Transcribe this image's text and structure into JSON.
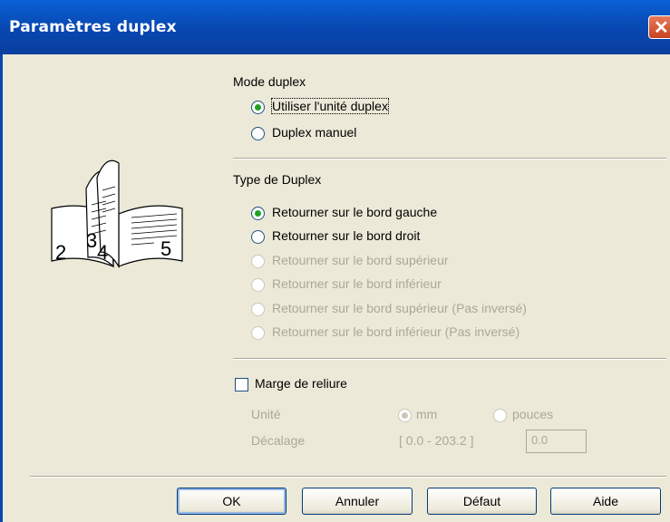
{
  "window": {
    "title": "Paramètres duplex",
    "close_glyph": "✕"
  },
  "illustration": {
    "page_numbers": [
      "2",
      "3",
      "4",
      "5"
    ]
  },
  "mode_duplex": {
    "heading": "Mode duplex",
    "options": [
      {
        "label": "Utiliser l'unité duplex",
        "selected": true,
        "enabled": true
      },
      {
        "label": "Duplex manuel",
        "selected": false,
        "enabled": true
      }
    ]
  },
  "type_duplex": {
    "heading": "Type de Duplex",
    "options": [
      {
        "label": "Retourner sur le bord gauche",
        "selected": true,
        "enabled": true
      },
      {
        "label": "Retourner sur le bord droit",
        "selected": false,
        "enabled": true
      },
      {
        "label": "Retourner sur le bord supérieur",
        "selected": false,
        "enabled": false
      },
      {
        "label": "Retourner sur le bord inférieur",
        "selected": false,
        "enabled": false
      },
      {
        "label": "Retourner sur le bord supérieur (Pas inversé)",
        "selected": false,
        "enabled": false
      },
      {
        "label": "Retourner sur le bord inférieur (Pas inversé)",
        "selected": false,
        "enabled": false
      }
    ]
  },
  "marge": {
    "checkbox_label": "Marge de reliure",
    "checked": false,
    "unit_label": "Unité",
    "unit_mm": "mm",
    "unit_inches": "pouces",
    "offset_label": "Décalage",
    "range": "[ 0.0 - 203.2 ]",
    "offset_value": "0.0"
  },
  "buttons": {
    "ok": "OK",
    "cancel": "Annuler",
    "default": "Défaut",
    "help": "Aide"
  },
  "colors": {
    "titlebar": "#0847b0",
    "dialog_bg": "#ece9d8",
    "radio_selected": "#21a121",
    "disabled_text": "#aca899"
  }
}
